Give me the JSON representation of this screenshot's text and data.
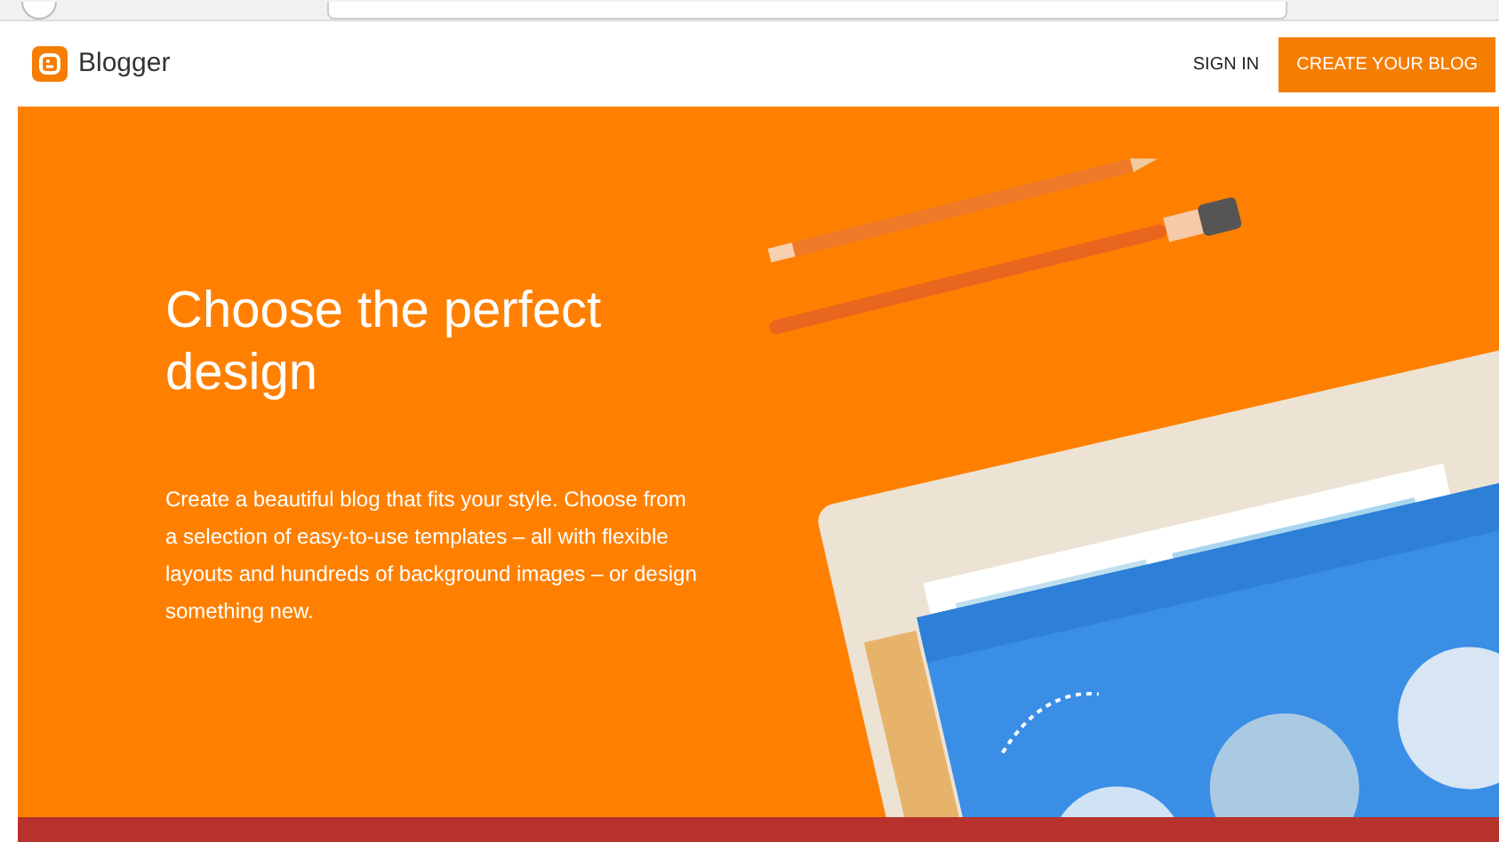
{
  "header": {
    "logo": "Blogger",
    "sign_in": "SIGN IN",
    "create_button": "CREATE YOUR BLOG"
  },
  "hero": {
    "title": "Choose the perfect design",
    "description": "Create a beautiful blog that fits your style. Choose from a selection of easy-to-use templates – all with flexible layouts and hundreds of background images – or design something new."
  }
}
